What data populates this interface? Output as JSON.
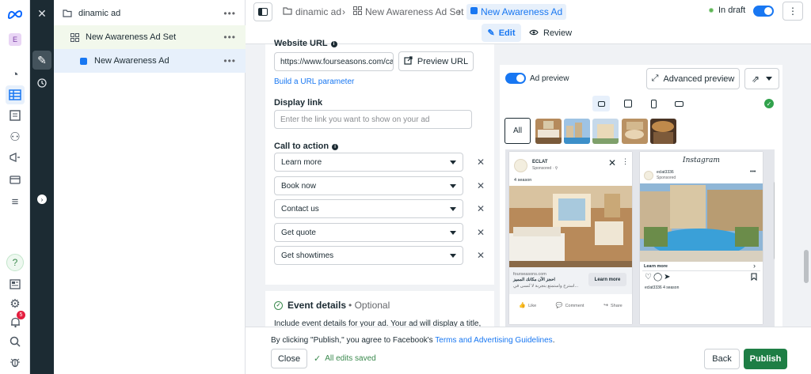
{
  "tree": {
    "campaign": "dinamic ad",
    "adset": "New Awareness Ad Set",
    "ad": "New Awareness Ad",
    "more": "•••"
  },
  "rail": {
    "avatar": "E",
    "notifications": "5"
  },
  "topbar": {
    "crumb_campaign": "dinamic ad",
    "crumb_adset": "New Awareness Ad Set",
    "crumb_ad": "New Awareness Ad",
    "status": "In draft",
    "edit_tab": "Edit",
    "review_tab": "Review"
  },
  "editor": {
    "website_url_label": "Website URL",
    "website_url_value": "https://www.fourseasons.com/cairo",
    "preview_url": "Preview URL",
    "build_param": "Build a URL parameter",
    "display_link_label": "Display link",
    "display_link_placeholder": "Enter the link you want to show on your ad",
    "cta_label": "Call to action",
    "cta_options": [
      "Learn more",
      "Book now",
      "Contact us",
      "Get quote",
      "Get showtimes"
    ],
    "event_title": "Event details",
    "event_optional": "• Optional",
    "event_desc": "Include event details for your ad. Your ad will display a title,"
  },
  "preview": {
    "toggle_label": "Ad preview",
    "advanced": "Advanced preview",
    "all": "All",
    "fb": {
      "name": "ECLAT",
      "sponsored": "Sponsored · ⚲",
      "text": "4 season",
      "url": "fourseasons.com",
      "arabic_title": "احجز الآن مكانك المميز",
      "arabic_desc": "استرخ واستمتع بتجربة لا تُنسى في...",
      "cta": "Learn more",
      "like": "Like",
      "comment": "Comment",
      "share": "Share"
    },
    "ig": {
      "brand": "Instagram",
      "name": "eclat3336",
      "sponsored": "Sponsored",
      "learn": "Learn more",
      "caption": "eclat3336 4 season"
    }
  },
  "bottom": {
    "terms_prefix": "By clicking \"Publish,\" you agree to Facebook's ",
    "terms_link": "Terms and Advertising Guidelines",
    "terms_suffix": ".",
    "close": "Close",
    "saved": "All edits saved",
    "back": "Back",
    "publish": "Publish"
  },
  "colors": {
    "accent": "#1877f2",
    "publish": "#1e7e45",
    "dark_strip": "#1c2b33"
  }
}
